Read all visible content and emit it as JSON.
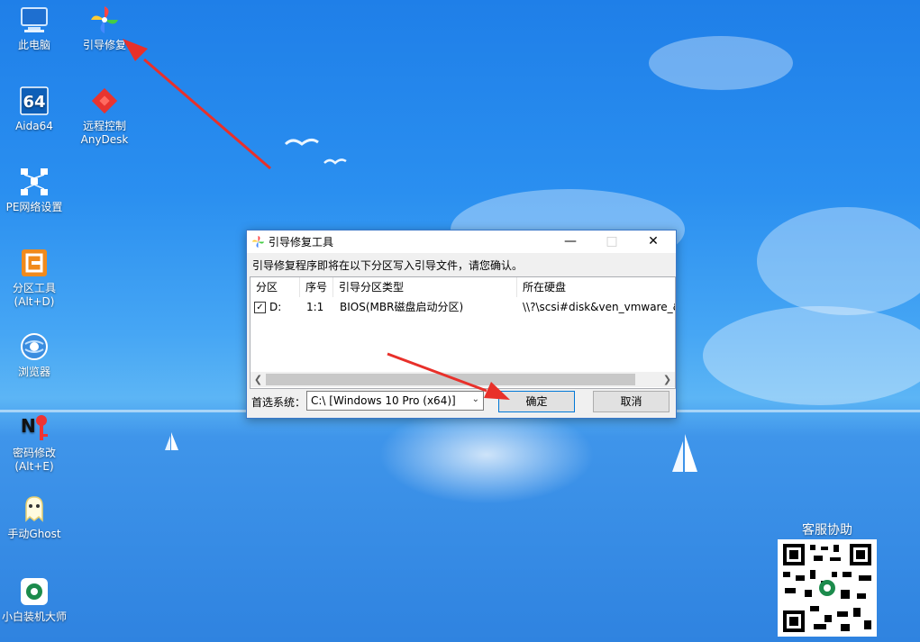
{
  "desktop": {
    "icons": [
      {
        "label": "此电脑",
        "icon": "computer-icon"
      },
      {
        "label": "引导修复",
        "icon": "pinwheel-icon"
      },
      {
        "label": "Aida64",
        "icon": "aida64-icon"
      },
      {
        "label": "远程控制",
        "label2": "AnyDesk",
        "icon": "anydesk-icon"
      },
      {
        "label": "PE网络设置",
        "icon": "network-icon"
      },
      {
        "label": "分区工具",
        "label2": "(Alt+D)",
        "icon": "partition-tool-icon"
      },
      {
        "label": "浏览器",
        "icon": "browser-icon"
      },
      {
        "label": "密码修改",
        "label2": "(Alt+E)",
        "icon": "password-icon"
      },
      {
        "label": "手动Ghost",
        "icon": "ghost-icon"
      },
      {
        "label": "小白装机大师",
        "icon": "installer-icon"
      }
    ],
    "qr_label": "客服协助"
  },
  "dialog": {
    "title": "引导修复工具",
    "message": "引导修复程序即将在以下分区写入引导文件，请您确认。",
    "columns": [
      "分区",
      "序号",
      "引导分区类型",
      "所在硬盘"
    ],
    "rows": [
      {
        "checked": true,
        "partition": "D:",
        "index": "1:1",
        "type": "BIOS(MBR磁盘启动分区)",
        "disk": "\\\\?\\scsi#disk&ven_vmware_&"
      }
    ],
    "prefer_label": "首选系统：",
    "prefer_value": "C:\\ [Windows 10 Pro (x64)]",
    "ok_label": "确定",
    "cancel_label": "取消"
  },
  "colors": {
    "accent": "#0078d7",
    "arrow": "#e8302a",
    "desktop": "#2a8ff0"
  }
}
